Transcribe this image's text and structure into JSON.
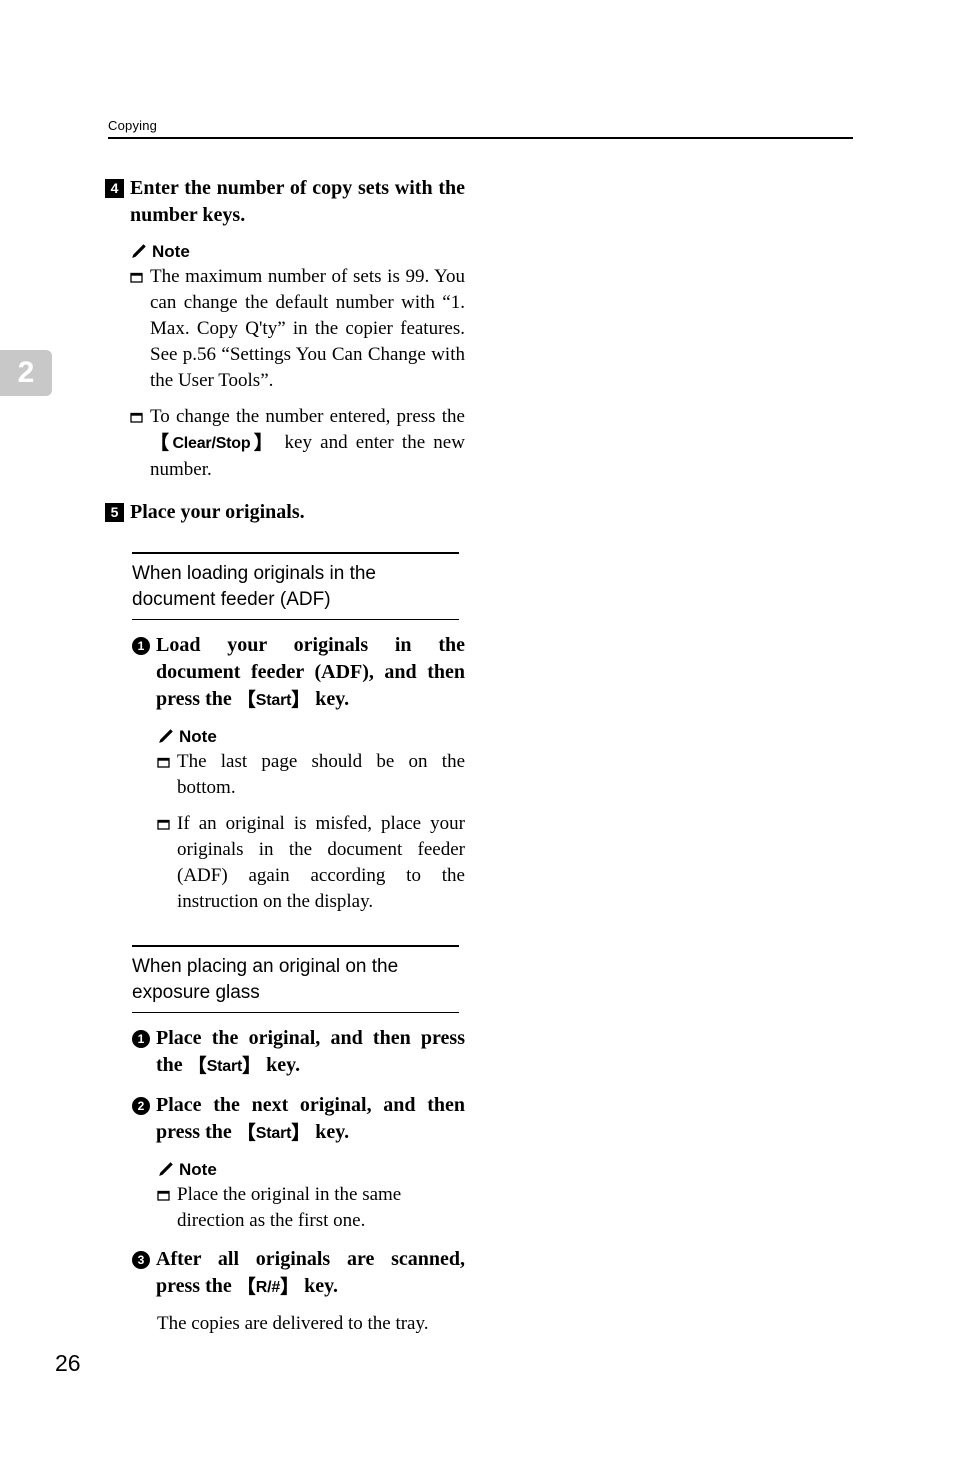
{
  "header": {
    "section_title": "Copying"
  },
  "chapter_tab": {
    "number": "2"
  },
  "page": {
    "number": "26"
  },
  "icons": {
    "note_pencil": "pencil-icon",
    "note_bullet": "square-bullet-icon"
  },
  "steps": [
    {
      "badge": "4",
      "text": "Enter the number of copy sets with the number keys.",
      "note_label": "Note",
      "notes": [
        {
          "pre": "The maximum number of sets is 99. You can change the default number with “1. Max. Copy Q'ty” in the copier features. See p.56 “Settings You Can Change with the User Tools”."
        },
        {
          "pre": "To change the number entered, press the ",
          "key_open": "【",
          "key": "Clear/Stop",
          "key_close": "】",
          "post": " key and enter the new number."
        }
      ]
    },
    {
      "badge": "5",
      "text": "Place your originals."
    }
  ],
  "subsections": [
    {
      "title": "When loading originals in the document feeder (ADF)",
      "substeps": [
        {
          "badge": "1",
          "pre": "Load your originals in the document feeder (ADF), and then press the ",
          "key_open": "【",
          "key": "Start",
          "key_close": "】",
          "post": " key."
        }
      ],
      "note_label": "Note",
      "notes": [
        {
          "pre": "The last page should be on the bottom."
        },
        {
          "pre": "If an original is misfed, place your originals in the document feeder (ADF) again according to the instruction on the display."
        }
      ]
    },
    {
      "title": "When placing an original on the exposure glass",
      "substeps_a": [
        {
          "badge": "1",
          "pre": "Place the original, and then press the ",
          "key_open": "【",
          "key": "Start",
          "key_close": "】",
          "post": " key."
        },
        {
          "badge": "2",
          "pre": "Place the next original, and then press the ",
          "key_open": "【",
          "key": "Start",
          "key_close": "】",
          "post": " key."
        }
      ],
      "note_label": "Note",
      "notes": [
        {
          "pre": "Place the original in the same direction as the first one."
        }
      ],
      "substeps_b": [
        {
          "badge": "3",
          "pre": "After all originals are scanned, press the ",
          "key_open": "【",
          "key": "R/#",
          "key_close": "】",
          "post": " key."
        }
      ],
      "closing_paragraph": "The copies are delivered to the tray."
    }
  ]
}
